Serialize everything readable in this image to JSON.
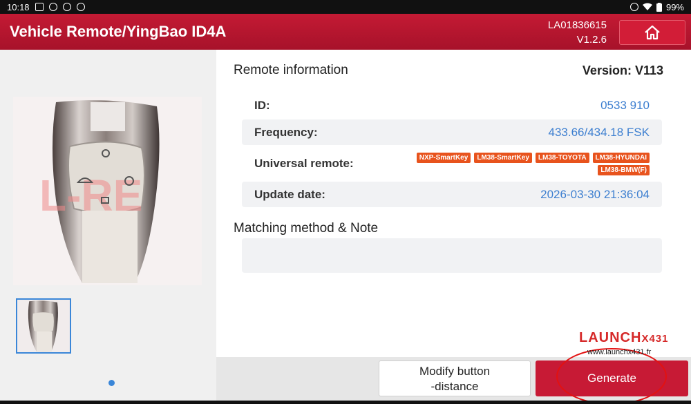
{
  "status_bar": {
    "time": "10:18",
    "battery": "99%"
  },
  "header": {
    "title": "Vehicle Remote/YingBao ID4A",
    "serial": "LA01836615",
    "app_version": "V1.2.6"
  },
  "remote_info": {
    "title": "Remote information",
    "version": "Version: V113",
    "rows": [
      {
        "label": "ID:",
        "value": "0533 910"
      },
      {
        "label": "Frequency:",
        "value": "433.66/434.18 FSK"
      },
      {
        "label": "Universal remote:"
      },
      {
        "label": "Update date:",
        "value": "2026-03-30 21:36:04"
      }
    ],
    "universal_tags": [
      "NXP-SmartKey",
      "LM38-SmartKey",
      "LM38-TOYOTA",
      "LM38-HYUNDAI",
      "LM38-BMW(F)"
    ]
  },
  "matching": {
    "title": "Matching method & Note"
  },
  "buttons": {
    "modify_line1": "Modify button",
    "modify_line2": "-distance",
    "generate": "Generate"
  },
  "watermark": {
    "logo": "LAUNCH",
    "logo_mark": "X431",
    "url": "www.launchx431.fr",
    "image_text": "L-RE"
  },
  "colors": {
    "brand_red": "#c41a34",
    "value_blue": "#3d7fd0",
    "tag_orange": "#e8531d"
  }
}
